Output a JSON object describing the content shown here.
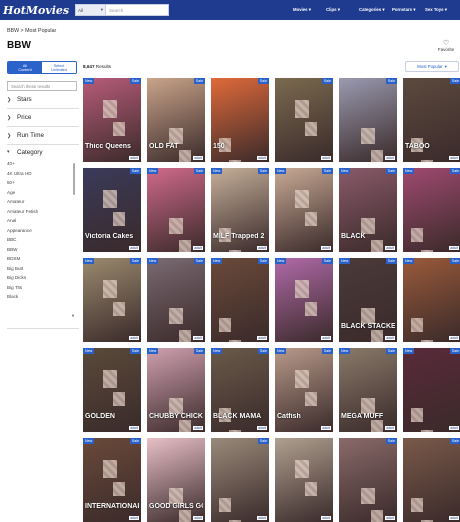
{
  "header": {
    "logo": "HotMovies",
    "search_scope": "All",
    "search_placeholder": "Search",
    "nav": [
      "Movies",
      "Clips",
      "Categories",
      "Pornstars",
      "Sex Toys"
    ]
  },
  "breadcrumb": "BBW > Most Popular",
  "title": "BBW",
  "favorite_label": "Favorite",
  "toggle": {
    "all_label": "All",
    "all_sub": "Content",
    "select_label": "Select",
    "select_sub": "Unlimited"
  },
  "results": {
    "count": "8,647",
    "label": "Results"
  },
  "sort": {
    "selected": "Most Popular"
  },
  "filter_search_placeholder": "Search these results",
  "facets": [
    "Stars",
    "Price",
    "Run Time"
  ],
  "category_heading": "Category",
  "categories": [
    "40+",
    "4K Ultra HD",
    "50+",
    "Age",
    "Amateur",
    "Amateur Fetish",
    "Anal",
    "Appearance",
    "BBC",
    "BBW",
    "BDSM",
    "Big Butt",
    "Big Dicks",
    "Big Tits",
    "Black"
  ],
  "badges": {
    "new": "New",
    "sale": "Sale",
    "studio": "adult"
  },
  "tiles": [
    {
      "caption": "Thicc Queens",
      "color": "#b85c7a",
      "new": true,
      "sale": true
    },
    {
      "caption": "OLD FAT",
      "color": "#c9a48a",
      "new": false,
      "sale": true
    },
    {
      "caption": "150",
      "color": "#e06a3a",
      "new": false,
      "sale": true
    },
    {
      "caption": "",
      "color": "#7a6a4f",
      "new": false,
      "sale": true
    },
    {
      "caption": "",
      "color": "#9a9ab0",
      "new": false,
      "sale": true
    },
    {
      "caption": "TABOO",
      "color": "#5c4a3e",
      "new": false,
      "sale": true
    },
    {
      "caption": "Victoria Cakes",
      "color": "#3a3a5a",
      "new": false,
      "sale": true
    },
    {
      "caption": "",
      "color": "#d06a8c",
      "new": true,
      "sale": true
    },
    {
      "caption": "MILF Trapped 2",
      "color": "#c6b09a",
      "new": true,
      "sale": true
    },
    {
      "caption": "",
      "color": "#c8aa95",
      "new": true,
      "sale": true
    },
    {
      "caption": "BLACK",
      "color": "#8a5a6a",
      "new": true,
      "sale": true
    },
    {
      "caption": "",
      "color": "#a04a70",
      "new": true,
      "sale": true
    },
    {
      "caption": "",
      "color": "#9a8a6e",
      "new": true,
      "sale": true
    },
    {
      "caption": "",
      "color": "#7a6a72",
      "new": true,
      "sale": true
    },
    {
      "caption": "",
      "color": "#6a4a3a",
      "new": true,
      "sale": true
    },
    {
      "caption": "",
      "color": "#b06aa8",
      "new": true,
      "sale": true
    },
    {
      "caption": "BLACK STACKED",
      "color": "#4a3a3a",
      "new": true,
      "sale": true
    },
    {
      "caption": "",
      "color": "#9a5a3a",
      "new": true,
      "sale": true
    },
    {
      "caption": "GOLDEN",
      "color": "#5a4a3a",
      "new": true,
      "sale": true
    },
    {
      "caption": "CHUBBY CHICKS",
      "color": "#d0a0b0",
      "new": true,
      "sale": true
    },
    {
      "caption": "BLACK MAMA",
      "color": "#6a5a4a",
      "new": true,
      "sale": true
    },
    {
      "caption": "Catfish",
      "color": "#b89a8a",
      "new": true,
      "sale": true
    },
    {
      "caption": "MEGA MUFF",
      "color": "#8a7a6a",
      "new": true,
      "sale": true
    },
    {
      "caption": "",
      "color": "#5a2a3a",
      "new": true,
      "sale": true
    },
    {
      "caption": "INTERNATIONAL",
      "color": "#6a4a3a",
      "new": true,
      "sale": true
    },
    {
      "caption": "GOOD GIRLS GONE",
      "color": "#e8c0c8",
      "new": false,
      "sale": false
    },
    {
      "caption": "",
      "color": "#9a8a7a",
      "new": false,
      "sale": true
    },
    {
      "caption": "",
      "color": "#b0a090",
      "new": false,
      "sale": false
    },
    {
      "caption": "",
      "color": "#8a6a6a",
      "new": false,
      "sale": true
    },
    {
      "caption": "",
      "color": "#7a5a4a",
      "new": false,
      "sale": true
    }
  ]
}
